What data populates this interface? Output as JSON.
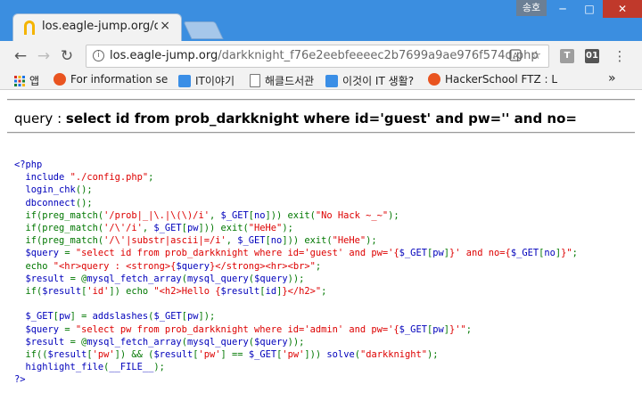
{
  "window": {
    "user_label": "송호",
    "minimize": "─",
    "maximize": "□",
    "close": "✕"
  },
  "tab": {
    "title": "los.eagle-jump.org/dark",
    "close": "×"
  },
  "toolbar": {
    "back": "←",
    "forward": "→",
    "reload": "↻",
    "url_host": "los.eagle-jump.org",
    "url_path": "/darkknight_f76e2eebfeeeec2b7699a9ae976f574d.php",
    "translate_icon": "translate-icon",
    "star_icon": "star-icon",
    "ext1_label": "T",
    "ext2_label": "01",
    "menu": "⋮"
  },
  "bookmarks": {
    "apps_label": "앱",
    "items": [
      {
        "label": "For information secu",
        "icon": "ubuntu-icon",
        "color": "#e95420"
      },
      {
        "label": "IT이야기",
        "icon": "folder-user-icon",
        "color": "#3a8ee6"
      },
      {
        "label": "해클드서관",
        "icon": "document-icon",
        "color": "#777777"
      },
      {
        "label": "이것이 IT 생활?",
        "icon": "folder-user-icon",
        "color": "#3a8ee6"
      },
      {
        "label": "HackerSchool FTZ : L",
        "icon": "ubuntu-icon",
        "color": "#e95420"
      }
    ],
    "more": "»"
  },
  "page": {
    "query_prefix": "query : ",
    "query_sql": "select id from prob_darkknight where id='guest' and pw='' and no="
  },
  "source_lines": [
    [
      {
        "c": "def",
        "t": "<?php"
      }
    ],
    [
      {
        "c": "def",
        "t": "  include "
      },
      {
        "c": "str",
        "t": "\"./config.php\""
      },
      {
        "c": "kw",
        "t": ";"
      }
    ],
    [
      {
        "c": "def",
        "t": "  login_chk"
      },
      {
        "c": "kw",
        "t": "();"
      }
    ],
    [
      {
        "c": "def",
        "t": "  dbconnect"
      },
      {
        "c": "kw",
        "t": "();"
      }
    ],
    [
      {
        "c": "kw",
        "t": "  if(preg_match("
      },
      {
        "c": "str",
        "t": "'/prob|_|\\.|\\(\\)/i'"
      },
      {
        "c": "kw",
        "t": ", "
      },
      {
        "c": "def",
        "t": "$_GET"
      },
      {
        "c": "kw",
        "t": "["
      },
      {
        "c": "def",
        "t": "no"
      },
      {
        "c": "kw",
        "t": "])) exit("
      },
      {
        "c": "str",
        "t": "\"No Hack ~_~\""
      },
      {
        "c": "kw",
        "t": ");"
      }
    ],
    [
      {
        "c": "kw",
        "t": "  if(preg_match("
      },
      {
        "c": "str",
        "t": "'/\\'/i'"
      },
      {
        "c": "kw",
        "t": ", "
      },
      {
        "c": "def",
        "t": "$_GET"
      },
      {
        "c": "kw",
        "t": "["
      },
      {
        "c": "def",
        "t": "pw"
      },
      {
        "c": "kw",
        "t": "])) exit("
      },
      {
        "c": "str",
        "t": "\"HeHe\""
      },
      {
        "c": "kw",
        "t": ");"
      }
    ],
    [
      {
        "c": "kw",
        "t": "  if(preg_match("
      },
      {
        "c": "str",
        "t": "'/\\'|substr|ascii|=/i'"
      },
      {
        "c": "kw",
        "t": ", "
      },
      {
        "c": "def",
        "t": "$_GET"
      },
      {
        "c": "kw",
        "t": "["
      },
      {
        "c": "def",
        "t": "no"
      },
      {
        "c": "kw",
        "t": "])) exit("
      },
      {
        "c": "str",
        "t": "\"HeHe\""
      },
      {
        "c": "kw",
        "t": ");"
      }
    ],
    [
      {
        "c": "def",
        "t": "  $query "
      },
      {
        "c": "kw",
        "t": "= "
      },
      {
        "c": "str",
        "t": "\"select id from prob_darkknight where id='guest' and pw='{"
      },
      {
        "c": "def",
        "t": "$_GET"
      },
      {
        "c": "kw",
        "t": "["
      },
      {
        "c": "def",
        "t": "pw"
      },
      {
        "c": "kw",
        "t": "]"
      },
      {
        "c": "str",
        "t": "}' and no={"
      },
      {
        "c": "def",
        "t": "$_GET"
      },
      {
        "c": "kw",
        "t": "["
      },
      {
        "c": "def",
        "t": "no"
      },
      {
        "c": "kw",
        "t": "]"
      },
      {
        "c": "str",
        "t": "}\""
      },
      {
        "c": "kw",
        "t": ";"
      }
    ],
    [
      {
        "c": "kw",
        "t": "  echo "
      },
      {
        "c": "str",
        "t": "\"<hr>query : <strong>{"
      },
      {
        "c": "def",
        "t": "$query"
      },
      {
        "c": "str",
        "t": "}</strong><hr><br>\""
      },
      {
        "c": "kw",
        "t": ";"
      }
    ],
    [
      {
        "c": "def",
        "t": "  $result "
      },
      {
        "c": "kw",
        "t": "= @"
      },
      {
        "c": "def",
        "t": "mysql_fetch_array"
      },
      {
        "c": "kw",
        "t": "("
      },
      {
        "c": "def",
        "t": "mysql_query"
      },
      {
        "c": "kw",
        "t": "("
      },
      {
        "c": "def",
        "t": "$query"
      },
      {
        "c": "kw",
        "t": "));"
      }
    ],
    [
      {
        "c": "kw",
        "t": "  if("
      },
      {
        "c": "def",
        "t": "$result"
      },
      {
        "c": "kw",
        "t": "["
      },
      {
        "c": "str",
        "t": "'id'"
      },
      {
        "c": "kw",
        "t": "]) echo "
      },
      {
        "c": "str",
        "t": "\"<h2>Hello {"
      },
      {
        "c": "def",
        "t": "$result"
      },
      {
        "c": "kw",
        "t": "["
      },
      {
        "c": "def",
        "t": "id"
      },
      {
        "c": "kw",
        "t": "]"
      },
      {
        "c": "str",
        "t": "}</h2>\""
      },
      {
        "c": "kw",
        "t": ";"
      }
    ],
    [
      {
        "c": "def",
        "t": ""
      }
    ],
    [
      {
        "c": "def",
        "t": "  $_GET"
      },
      {
        "c": "kw",
        "t": "["
      },
      {
        "c": "def",
        "t": "pw"
      },
      {
        "c": "kw",
        "t": "] = "
      },
      {
        "c": "def",
        "t": "addslashes"
      },
      {
        "c": "kw",
        "t": "("
      },
      {
        "c": "def",
        "t": "$_GET"
      },
      {
        "c": "kw",
        "t": "["
      },
      {
        "c": "def",
        "t": "pw"
      },
      {
        "c": "kw",
        "t": "]);"
      }
    ],
    [
      {
        "c": "def",
        "t": "  $query "
      },
      {
        "c": "kw",
        "t": "= "
      },
      {
        "c": "str",
        "t": "\"select pw from prob_darkknight where id='admin' and pw='{"
      },
      {
        "c": "def",
        "t": "$_GET"
      },
      {
        "c": "kw",
        "t": "["
      },
      {
        "c": "def",
        "t": "pw"
      },
      {
        "c": "kw",
        "t": "]"
      },
      {
        "c": "str",
        "t": "}'\""
      },
      {
        "c": "kw",
        "t": ";"
      }
    ],
    [
      {
        "c": "def",
        "t": "  $result "
      },
      {
        "c": "kw",
        "t": "= @"
      },
      {
        "c": "def",
        "t": "mysql_fetch_array"
      },
      {
        "c": "kw",
        "t": "("
      },
      {
        "c": "def",
        "t": "mysql_query"
      },
      {
        "c": "kw",
        "t": "("
      },
      {
        "c": "def",
        "t": "$query"
      },
      {
        "c": "kw",
        "t": "));"
      }
    ],
    [
      {
        "c": "kw",
        "t": "  if(("
      },
      {
        "c": "def",
        "t": "$result"
      },
      {
        "c": "kw",
        "t": "["
      },
      {
        "c": "str",
        "t": "'pw'"
      },
      {
        "c": "kw",
        "t": "]) && ("
      },
      {
        "c": "def",
        "t": "$result"
      },
      {
        "c": "kw",
        "t": "["
      },
      {
        "c": "str",
        "t": "'pw'"
      },
      {
        "c": "kw",
        "t": "] == "
      },
      {
        "c": "def",
        "t": "$_GET"
      },
      {
        "c": "kw",
        "t": "["
      },
      {
        "c": "str",
        "t": "'pw'"
      },
      {
        "c": "kw",
        "t": "])) "
      },
      {
        "c": "def",
        "t": "solve"
      },
      {
        "c": "kw",
        "t": "("
      },
      {
        "c": "str",
        "t": "\"darkknight\""
      },
      {
        "c": "kw",
        "t": ");"
      }
    ],
    [
      {
        "c": "def",
        "t": "  highlight_file"
      },
      {
        "c": "kw",
        "t": "("
      },
      {
        "c": "def",
        "t": "__FILE__"
      },
      {
        "c": "kw",
        "t": ");"
      }
    ],
    [
      {
        "c": "def",
        "t": "?>"
      }
    ]
  ]
}
